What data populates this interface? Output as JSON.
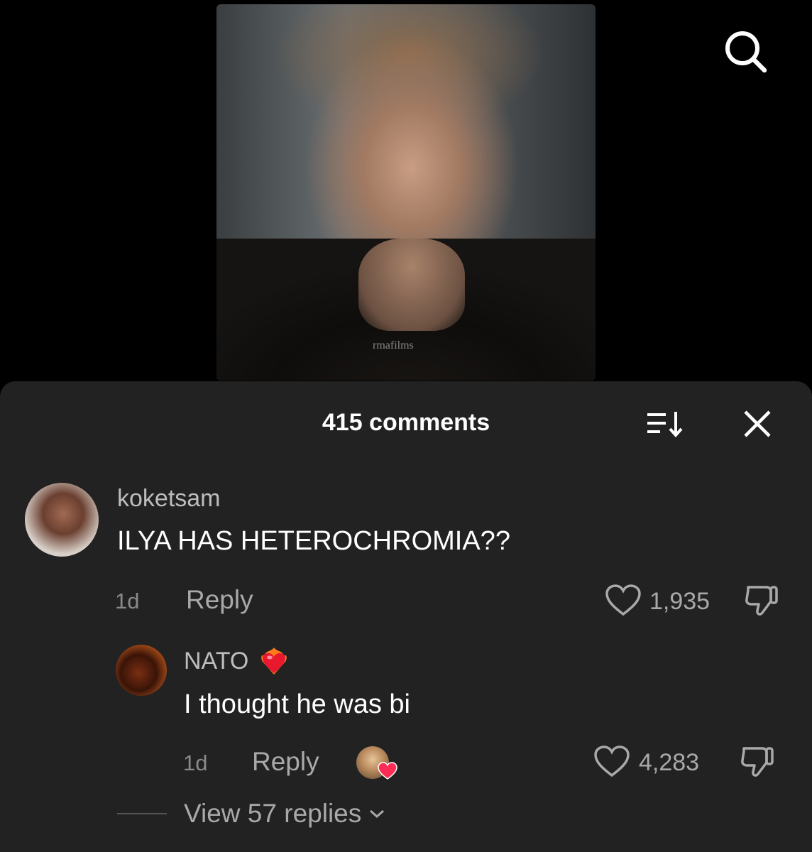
{
  "video": {
    "watermark": "rmafilms"
  },
  "comments_sheet": {
    "title": "415 comments",
    "comments": [
      {
        "username": "koketsam",
        "text": "ILYA HAS HETEROCHROMIA??",
        "age": "1d",
        "reply_label": "Reply",
        "likes": "1,935"
      },
      {
        "username": "NATO",
        "text": "I thought he was bi",
        "age": "1d",
        "reply_label": "Reply",
        "likes": "4,283",
        "badge_icon": "heart-on-fire-emoji",
        "creator_liked": true
      }
    ],
    "view_replies_label": "View 57 replies"
  },
  "colors": {
    "sheet_background": "#222222",
    "page_background": "#000000",
    "like_red": "#fe2c55"
  }
}
